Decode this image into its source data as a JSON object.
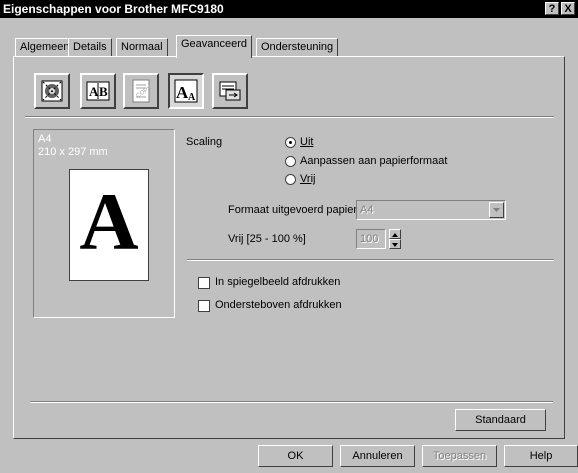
{
  "window": {
    "title": "Eigenschappen voor Brother MFC9180",
    "help_btn": "?",
    "close_btn": "X"
  },
  "tabs": [
    {
      "label": "Algemeen"
    },
    {
      "label": "Details"
    },
    {
      "label": "Normaal"
    },
    {
      "label": "Geavanceerd",
      "active": true
    },
    {
      "label": "Ondersteuning"
    }
  ],
  "toolbar": [
    {
      "icon": "quality-icon"
    },
    {
      "icon": "ab-compare-icon"
    },
    {
      "icon": "copy-watermark-icon"
    },
    {
      "icon": "scaling-icon",
      "selected": true
    },
    {
      "icon": "output-icon"
    }
  ],
  "preview": {
    "paper_name": "A4",
    "paper_size": "210 x 297 mm",
    "glyph": "A"
  },
  "scaling": {
    "label": "Scaling",
    "options": [
      {
        "label": "Uit",
        "selected": true
      },
      {
        "label": "Aanpassen aan papierformaat",
        "selected": false
      },
      {
        "label": "Vrij",
        "selected": false
      }
    ],
    "output_paper_label": "Formaat uitgevoerd papier",
    "output_paper_value": "A4",
    "free_label": "Vrij [25 - 100 %]",
    "free_value": "100"
  },
  "options": {
    "mirror": {
      "label": "In spiegelbeeld afdrukken",
      "checked": false
    },
    "upside_down": {
      "label": "Ondersteboven afdrukken",
      "checked": false
    }
  },
  "buttons": {
    "default": "Standaard",
    "ok": "OK",
    "cancel": "Annuleren",
    "apply": "Toepassen",
    "help": "Help"
  }
}
